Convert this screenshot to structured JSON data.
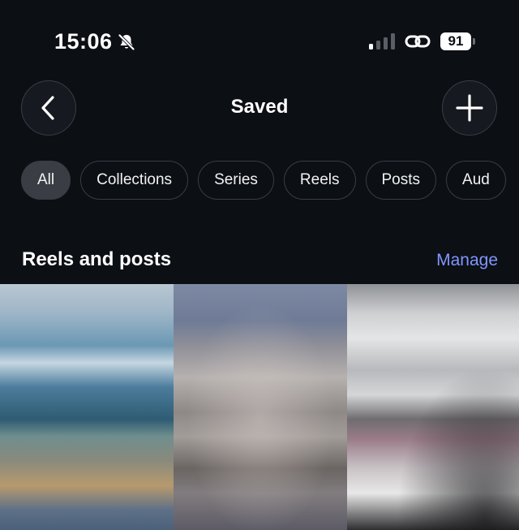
{
  "status_bar": {
    "time": "15:06",
    "battery": "91",
    "icons": [
      "bell-slash-icon",
      "signal-icon",
      "link-icon",
      "battery-icon"
    ]
  },
  "header": {
    "title": "Saved",
    "back_icon": "chevron-left-icon",
    "add_icon": "plus-icon"
  },
  "filters": [
    {
      "label": "All",
      "active": true
    },
    {
      "label": "Collections",
      "active": false
    },
    {
      "label": "Series",
      "active": false
    },
    {
      "label": "Reels",
      "active": false
    },
    {
      "label": "Posts",
      "active": false
    },
    {
      "label": "Aud",
      "active": false
    }
  ],
  "section": {
    "title": "Reels and posts",
    "action": "Manage"
  },
  "colors": {
    "background": "#0c0f14",
    "accent": "#7f97ff",
    "chip_border": "#3a3d44",
    "chip_active": "#3a3d44"
  }
}
